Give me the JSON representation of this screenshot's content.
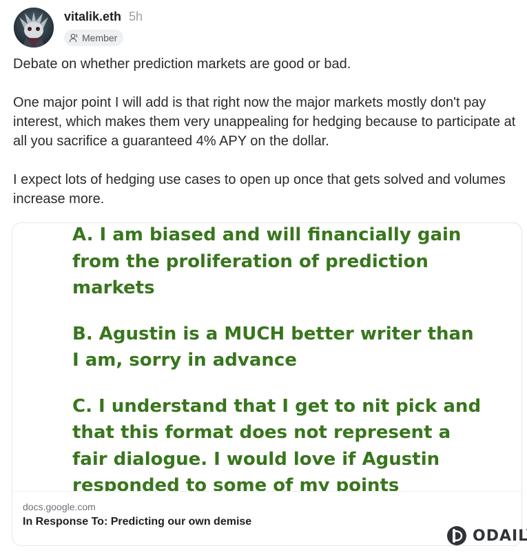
{
  "post": {
    "author": "vitalik.eth",
    "time": "5h",
    "badge": "Member",
    "badge_icon": "person-icon",
    "paragraphs": [
      "Debate on whether prediction markets are good or bad.",
      "One major point I will add is that right now the major markets mostly don't pay interest, which makes them very unappealing for hedging because to participate at all you sacrifice a guaranteed 4% APY on the dollar.",
      "I expect lots of hedging use cases to open up once that gets solved and volumes increase more."
    ]
  },
  "link_card": {
    "image_lines": [
      "A. I am biased and will financially gain from the proliferation of prediction markets",
      "B. Agustin is a MUCH better writer than I am, sorry in advance",
      "C. I understand that I get to nit pick and that this format does not represent a fair dialogue. I would love if Agustin responded to some of my points"
    ],
    "image_text_color": "#38761d",
    "domain": "docs.google.com",
    "title": "In Response To: Predicting our own demise"
  },
  "watermark": {
    "text": "ODAILY"
  }
}
